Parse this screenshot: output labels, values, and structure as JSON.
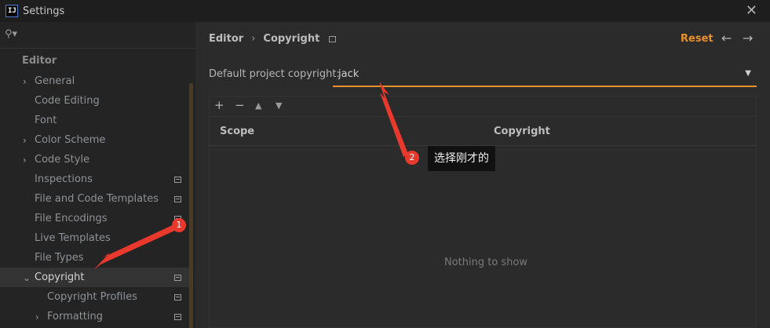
{
  "window": {
    "app_icon": "IJ",
    "title": "Settings",
    "close_icon": "close-icon"
  },
  "sidebar": {
    "search_icon": "search-icon",
    "section": "Editor",
    "items": [
      {
        "label": "General",
        "chevron": "right"
      },
      {
        "label": "Code Editing"
      },
      {
        "label": "Font"
      },
      {
        "label": "Color Scheme",
        "chevron": "right"
      },
      {
        "label": "Code Style",
        "chevron": "right"
      },
      {
        "label": "Inspections",
        "project_icon": true
      },
      {
        "label": "File and Code Templates",
        "project_icon": true
      },
      {
        "label": "File Encodings",
        "project_icon": true
      },
      {
        "label": "Live Templates"
      },
      {
        "label": "File Types"
      },
      {
        "label": "Copyright",
        "chevron": "down",
        "project_icon": true,
        "selected": true
      },
      {
        "label": "Copyright Profiles",
        "project_icon": true
      },
      {
        "label": "Formatting",
        "chevron": "right",
        "project_icon": true
      }
    ]
  },
  "breadcrumb": {
    "parent": "Editor",
    "separator": "›",
    "current": "Copyright"
  },
  "header": {
    "reset_label": "Reset",
    "back_icon": "←",
    "forward_icon": "→"
  },
  "form": {
    "default_copyright_label": "Default project copyright:",
    "default_copyright_value": "jack"
  },
  "table": {
    "tools": [
      "+",
      "−",
      "▲",
      "▼"
    ],
    "columns": [
      "Scope",
      "Copyright"
    ],
    "empty_text": "Nothing to show"
  },
  "annotations": {
    "badge_1": "1",
    "badge_2": "2",
    "callout_text": "选择刚才的",
    "arrow_color": "#e8392c"
  },
  "colors": {
    "accent": "#e8912d",
    "background": "#2b2b2b",
    "sidebar": "#242424"
  }
}
